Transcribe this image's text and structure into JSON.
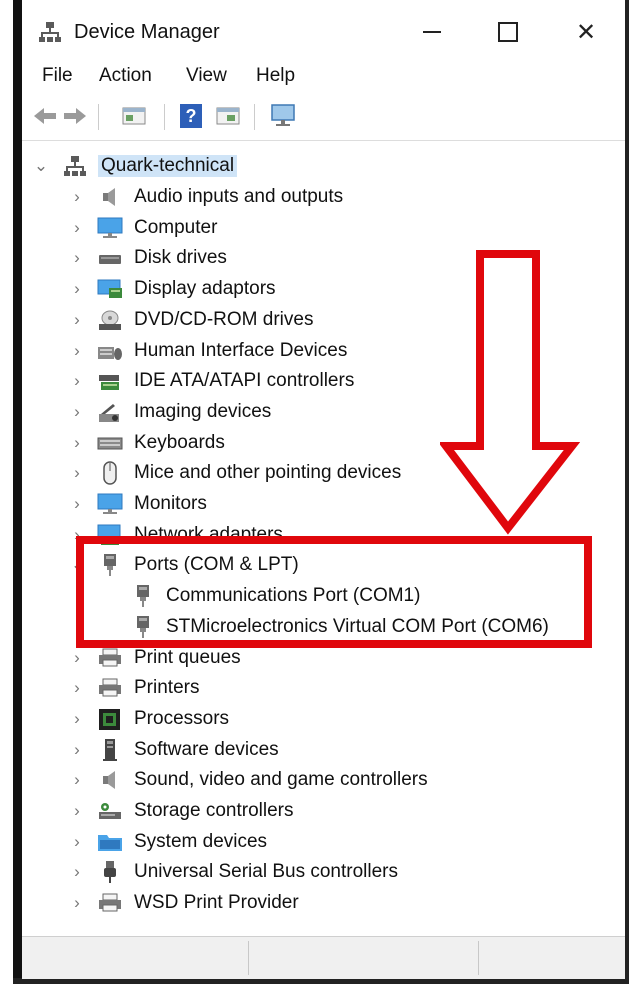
{
  "window": {
    "title": "Device Manager",
    "minimize_glyph": "—",
    "maximize_glyph": "☐",
    "close_glyph": "✕"
  },
  "menu": [
    "File",
    "Action",
    "View",
    "Help"
  ],
  "toolbar": {
    "buttons": [
      "back-arrow-icon",
      "forward-arrow-icon",
      "properties-icon",
      "help-icon",
      "update-driver-icon",
      "scan-hardware-icon"
    ],
    "help_glyph": "?"
  },
  "tree": {
    "root": {
      "label": "Quark-technical",
      "expanded": true,
      "chevron": "⌄"
    },
    "collapsed_chevron": "›",
    "items": [
      {
        "label": "Audio inputs and outputs",
        "icon": "speaker-icon"
      },
      {
        "label": "Computer",
        "icon": "monitor-icon"
      },
      {
        "label": "Disk drives",
        "icon": "disk-drive-icon"
      },
      {
        "label": "Display adaptors",
        "icon": "display-adapter-icon"
      },
      {
        "label": "DVD/CD-ROM drives",
        "icon": "dvd-drive-icon"
      },
      {
        "label": "Human Interface Devices",
        "icon": "hid-icon"
      },
      {
        "label": "IDE ATA/ATAPI controllers",
        "icon": "ide-controller-icon"
      },
      {
        "label": "Imaging devices",
        "icon": "camera-icon"
      },
      {
        "label": "Keyboards",
        "icon": "keyboard-icon"
      },
      {
        "label": "Mice and other pointing devices",
        "icon": "mouse-icon"
      },
      {
        "label": "Monitors",
        "icon": "monitor-icon"
      },
      {
        "label": "Network adapters",
        "icon": "network-adapter-icon"
      },
      {
        "label": "Ports (COM & LPT)",
        "icon": "port-icon",
        "expanded": true
      },
      {
        "label": "Communications Port (COM1)",
        "icon": "port-icon",
        "child": true
      },
      {
        "label": "STMicroelectronics Virtual COM Port (COM6)",
        "icon": "port-icon",
        "child": true
      },
      {
        "label": "Print queues",
        "icon": "printer-icon"
      },
      {
        "label": "Printers",
        "icon": "printer-icon"
      },
      {
        "label": "Processors",
        "icon": "processor-icon"
      },
      {
        "label": "Software devices",
        "icon": "software-device-icon"
      },
      {
        "label": "Sound, video and game controllers",
        "icon": "speaker-icon"
      },
      {
        "label": "Storage controllers",
        "icon": "storage-controller-icon"
      },
      {
        "label": "System devices",
        "icon": "folder-icon"
      },
      {
        "label": "Universal Serial Bus controllers",
        "icon": "usb-icon"
      },
      {
        "label": "WSD Print Provider",
        "icon": "printer-icon"
      }
    ]
  },
  "annotation": {
    "color": "#e0070c"
  },
  "colors": {
    "selection": "#cfe4f7",
    "accent": "#e0070c"
  }
}
